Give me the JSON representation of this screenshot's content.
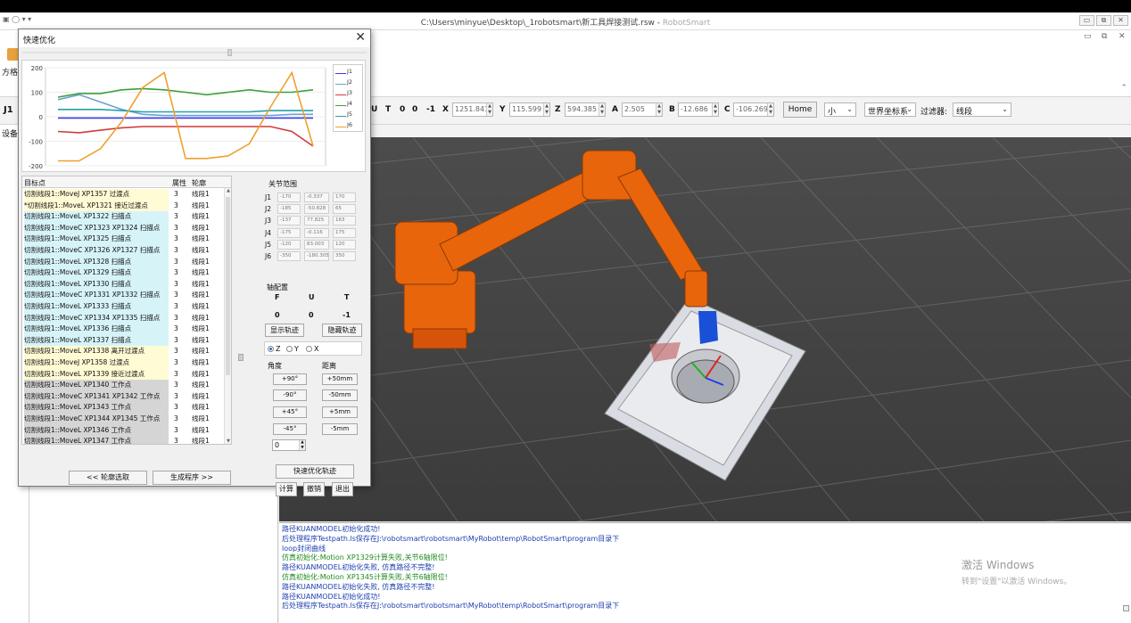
{
  "window": {
    "title_path": "C:\\Users\\minyue\\Desktop\\_1robotsmart\\新工具焊接测试.rsw",
    "title_separator": " - ",
    "app_name": "RobotSmart",
    "quick_access": "▣ ◯ ▾  ▾",
    "min_glyph": "▭",
    "max_glyph": "⧉",
    "close_glyph": "✕"
  },
  "ribbon": {
    "label": "方格",
    "collapse_glyph": "⌃"
  },
  "coordbar": {
    "j1": "J1",
    "letters": [
      "U",
      "T",
      "0",
      "0",
      "-1"
    ],
    "fields": [
      {
        "axis": "X",
        "value": "1251.841"
      },
      {
        "axis": "Y",
        "value": "115.599"
      },
      {
        "axis": "Z",
        "value": "594.385"
      },
      {
        "axis": "A",
        "value": "2.505"
      },
      {
        "axis": "B",
        "value": "-12.686"
      },
      {
        "axis": "C",
        "value": "-106.269"
      }
    ],
    "home": "Home",
    "size_select": "小",
    "frame_select": "世界坐标系",
    "filter_label": "过滤器:",
    "filter_select": "线段"
  },
  "leftpanel": {
    "tab": "设备"
  },
  "log": {
    "lines": [
      {
        "text": "路径KUANMODEL初始化成功!",
        "color": "blue"
      },
      {
        "text": "后处理程序Testpath.ls保存在J:\\robotsmart\\robotsmart\\MyRobot\\temp\\RobotSmart\\program目录下",
        "color": "blue"
      },
      {
        "text": "loop封闭曲线",
        "color": "blue"
      },
      {
        "text": "仿真初始化:Motion XP1329计算失败,关节6轴限位!",
        "color": "green"
      },
      {
        "text": "路径KUANMODEL初始化失败, 仿真路径不完整!",
        "color": "blue"
      },
      {
        "text": "仿真初始化:Motion XP1345计算失败,关节6轴限位!",
        "color": "green"
      },
      {
        "text": "路径KUANMODEL初始化失败, 仿真路径不完整!",
        "color": "blue"
      },
      {
        "text": "路径KUANMODEL初始化成功!",
        "color": "blue"
      },
      {
        "text": "后处理程序Testpath.ls保存在J:\\robotsmart\\robotsmart\\MyRobot\\temp\\RobotSmart\\program目录下",
        "color": "blue"
      }
    ],
    "watermark_title": "激活 Windows",
    "watermark_sub": "转到\"设置\"以激活 Windows。"
  },
  "dialog": {
    "title": "快速优化",
    "close": "✕",
    "chart_data": {
      "type": "line",
      "ylim": [
        -200,
        200
      ],
      "yticks": [
        "200",
        "100",
        "0",
        "-100",
        "-200"
      ],
      "series": [
        {
          "name": "J1",
          "color": "#3a3af0",
          "values": [
            -5,
            -5,
            -5,
            -5,
            -5,
            -5,
            -5,
            -5,
            -5,
            -5,
            -5,
            -5,
            -5
          ]
        },
        {
          "name": "J2",
          "color": "#6aa2d6",
          "values": [
            70,
            90,
            60,
            30,
            10,
            5,
            5,
            5,
            5,
            5,
            5,
            10,
            10
          ]
        },
        {
          "name": "J3",
          "color": "#d13a3a",
          "values": [
            -60,
            -65,
            -55,
            -45,
            -40,
            -40,
            -40,
            -40,
            -40,
            -40,
            -40,
            -60,
            -120
          ]
        },
        {
          "name": "J4",
          "color": "#3aa03a",
          "values": [
            80,
            95,
            95,
            110,
            115,
            110,
            100,
            90,
            100,
            110,
            100,
            100,
            110
          ]
        },
        {
          "name": "J5",
          "color": "#25a0a8",
          "values": [
            30,
            30,
            30,
            25,
            20,
            20,
            20,
            20,
            20,
            20,
            25,
            25,
            25
          ]
        },
        {
          "name": "J6",
          "color": "#f0a030",
          "values": [
            -180,
            -180,
            -130,
            -20,
            120,
            180,
            -170,
            -170,
            -160,
            -110,
            40,
            180,
            -120
          ]
        }
      ]
    },
    "table": {
      "headers": [
        "目标点",
        "属性",
        "轮廓"
      ],
      "rows": [
        {
          "name": "切割线段1::MoveJ XP1357 过渡点",
          "attr": "3",
          "contour": "线段1",
          "bg": "yellow"
        },
        {
          "name": "*切割线段1::MoveL XP1321 接近过渡点",
          "attr": "3",
          "contour": "线段1",
          "bg": "yellow"
        },
        {
          "name": "切割线段1::MoveL XP1322 扫描点",
          "attr": "3",
          "contour": "线段1",
          "bg": "cyan"
        },
        {
          "name": "切割线段1::MoveC XP1323 XP1324 扫描点",
          "attr": "3",
          "contour": "线段1",
          "bg": "cyan"
        },
        {
          "name": "切割线段1::MoveL XP1325 扫描点",
          "attr": "3",
          "contour": "线段1",
          "bg": "cyan"
        },
        {
          "name": "切割线段1::MoveC XP1326 XP1327 扫描点",
          "attr": "3",
          "contour": "线段1",
          "bg": "cyan"
        },
        {
          "name": "切割线段1::MoveL XP1328 扫描点",
          "attr": "3",
          "contour": "线段1",
          "bg": "cyan"
        },
        {
          "name": "切割线段1::MoveL XP1329 扫描点",
          "attr": "3",
          "contour": "线段1",
          "bg": "cyan"
        },
        {
          "name": "切割线段1::MoveL XP1330 扫描点",
          "attr": "3",
          "contour": "线段1",
          "bg": "cyan"
        },
        {
          "name": "切割线段1::MoveC XP1331 XP1332 扫描点",
          "attr": "3",
          "contour": "线段1",
          "bg": "cyan"
        },
        {
          "name": "切割线段1::MoveL XP1333 扫描点",
          "attr": "3",
          "contour": "线段1",
          "bg": "cyan"
        },
        {
          "name": "切割线段1::MoveC XP1334 XP1335 扫描点",
          "attr": "3",
          "contour": "线段1",
          "bg": "cyan"
        },
        {
          "name": "切割线段1::MoveL XP1336 扫描点",
          "attr": "3",
          "contour": "线段1",
          "bg": "cyan"
        },
        {
          "name": "切割线段1::MoveL XP1337 扫描点",
          "attr": "3",
          "contour": "线段1",
          "bg": "cyan"
        },
        {
          "name": "切割线段1::MoveL XP1338 离开过渡点",
          "attr": "3",
          "contour": "线段1",
          "bg": "yellow"
        },
        {
          "name": "切割线段1::MoveJ XP1358 过渡点",
          "attr": "3",
          "contour": "线段1",
          "bg": "yellow"
        },
        {
          "name": "切割线段1::MoveL XP1339 接近过渡点",
          "attr": "3",
          "contour": "线段1",
          "bg": "yellow"
        },
        {
          "name": "切割线段1::MoveL XP1340 工作点",
          "attr": "3",
          "contour": "线段1",
          "bg": "gray"
        },
        {
          "name": "切割线段1::MoveC XP1341 XP1342 工作点",
          "attr": "3",
          "contour": "线段1",
          "bg": "gray"
        },
        {
          "name": "切割线段1::MoveL XP1343 工作点",
          "attr": "3",
          "contour": "线段1",
          "bg": "gray"
        },
        {
          "name": "切割线段1::MoveC XP1344 XP1345 工作点",
          "attr": "3",
          "contour": "线段1",
          "bg": "gray"
        },
        {
          "name": "切割线段1::MoveL XP1346 工作点",
          "attr": "3",
          "contour": "线段1",
          "bg": "gray"
        },
        {
          "name": "切割线段1::MoveL XP1347 工作点",
          "attr": "3",
          "contour": "线段1",
          "bg": "gray"
        }
      ]
    },
    "joint_range": {
      "title": "关节范围",
      "rows": [
        {
          "j": "J1",
          "min": "-170",
          "cur": "-0.337",
          "max": "170"
        },
        {
          "j": "J2",
          "min": "-185",
          "cur": "-50.828",
          "max": "65"
        },
        {
          "j": "J3",
          "min": "-137",
          "cur": "77.825",
          "max": "163"
        },
        {
          "j": "J4",
          "min": "-175",
          "cur": "-0.116",
          "max": "175"
        },
        {
          "j": "J5",
          "min": "-120",
          "cur": "83.003",
          "max": "120"
        },
        {
          "j": "J6",
          "min": "-350",
          "cur": "-180.305",
          "max": "350"
        }
      ]
    },
    "axis_config": {
      "title": "轴配置",
      "headers": [
        "F",
        "U",
        "T"
      ],
      "values": [
        "0",
        "0",
        "-1"
      ]
    },
    "show_path": "显示轨迹",
    "hide_path": "隐藏轨迹",
    "radio": {
      "z": "Z",
      "y": "Y",
      "x": "X"
    },
    "angle_title": "角度",
    "distance_title": "距离",
    "angle_buttons": [
      "+90°",
      "-90°",
      "+45°",
      "-45°"
    ],
    "distance_buttons": [
      "+50mm",
      "-50mm",
      "+5mm",
      "-5mm"
    ],
    "angle_value": "0",
    "quick_opt": "快速优化轨迹",
    "calc": "计算",
    "undo": "撤销",
    "exit": "退出",
    "prev": "<<   轮廓选取",
    "gen": "生成程序   >>"
  }
}
